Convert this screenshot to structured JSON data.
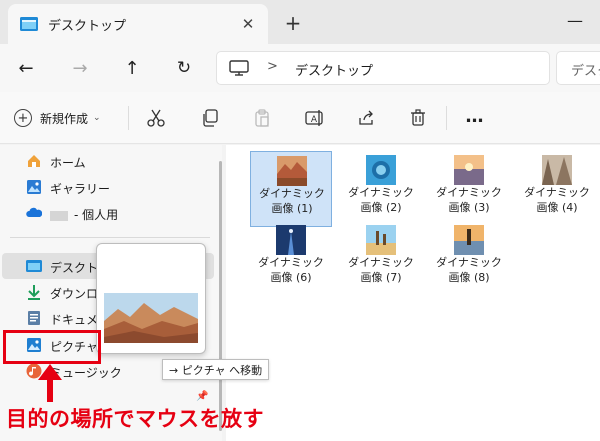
{
  "window": {
    "tab_title": "デスクトップ",
    "close_glyph": "✕",
    "new_tab_glyph": "+",
    "minimize_glyph": "—"
  },
  "address": {
    "path_separator": ">",
    "current_folder": "デスクトップ",
    "search_placeholder": "デスクトップの検索"
  },
  "nav": {
    "back": "←",
    "forward": "→",
    "up": "↑",
    "refresh": "↻"
  },
  "command_bar": {
    "new_label": "新規作成",
    "new_caret": "⌄",
    "more": "…"
  },
  "sidebar": {
    "items": [
      {
        "label": "ホーム",
        "icon": "home-icon"
      },
      {
        "label": "ギャラリー",
        "icon": "gallery-icon"
      },
      {
        "label": "- 個人用",
        "icon": "onedrive-icon"
      },
      {
        "label": "デスクトップ",
        "icon": "desktop-icon"
      },
      {
        "label": "ダウンロード",
        "icon": "download-icon"
      },
      {
        "label": "ドキュメント",
        "icon": "documents-icon"
      },
      {
        "label": "ピクチャ",
        "icon": "pictures-icon"
      },
      {
        "label": "ミュージック",
        "icon": "music-icon"
      }
    ]
  },
  "files": [
    {
      "name": "ダイナミック画像 (1)",
      "line1": "ダイナミック",
      "line2": "画像 (1)"
    },
    {
      "name": "ダイナミック画像 (2)",
      "line1": "ダイナミック",
      "line2": "画像 (2)"
    },
    {
      "name": "ダイナミック画像 (3)",
      "line1": "ダイナミック",
      "line2": "画像 (3)"
    },
    {
      "name": "ダイナミック画像 (4)",
      "line1": "ダイナミック",
      "line2": "画像 (4)"
    },
    {
      "name": "ダイナミック画像 (6)",
      "line1": "ダイナミック",
      "line2": "画像 (6)"
    },
    {
      "name": "ダイナミック画像 (7)",
      "line1": "ダイナミック",
      "line2": "画像 (7)"
    },
    {
      "name": "ダイナミック画像 (8)",
      "line1": "ダイナミック",
      "line2": "画像 (8)"
    }
  ],
  "drag": {
    "tooltip": "→ ピクチャ へ移動"
  },
  "annotation": {
    "text": "目的の場所でマウスを放す",
    "color": "#e60012"
  }
}
